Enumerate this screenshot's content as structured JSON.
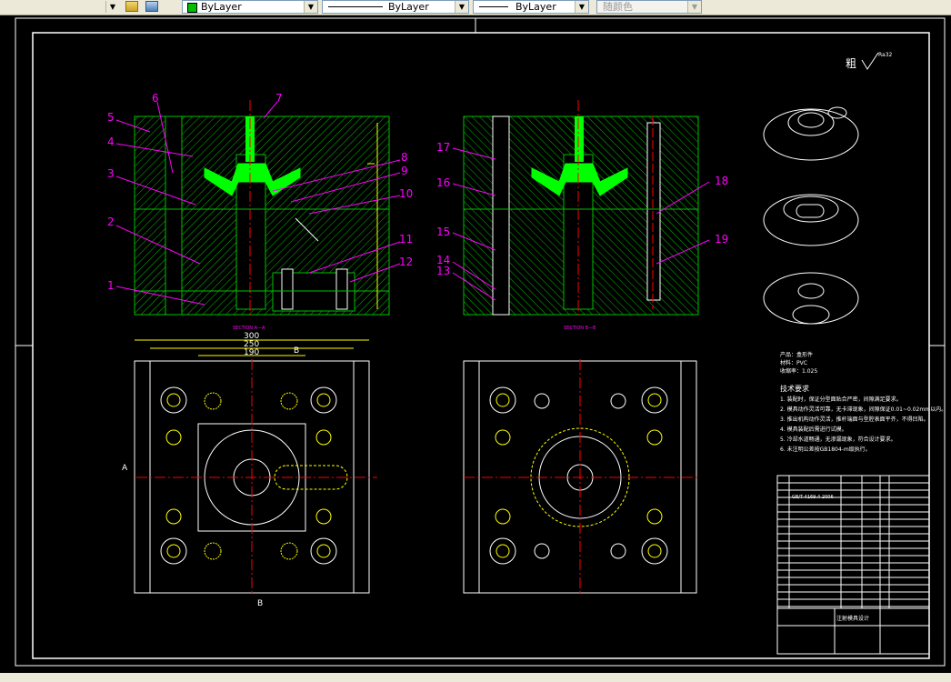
{
  "toolbar": {
    "layer_color": "ByLayer",
    "linetype": "ByLayer",
    "lineweight": "ByLayer",
    "plot_style": "随颜色"
  },
  "drawing": {
    "roughness_label": "粗",
    "roughness_value": "Ra32",
    "section_a_label": "SECTION A—A",
    "section_b_label": "SECTION B—B",
    "dim_300": "300",
    "dim_250": "250",
    "dim_190": "190",
    "label_A": "A",
    "label_B": "B",
    "part_numbers_left": [
      "1",
      "2",
      "3",
      "4",
      "5",
      "6",
      "7",
      "8",
      "9",
      "10",
      "11",
      "12"
    ],
    "part_numbers_right": [
      "13",
      "14",
      "15",
      "16",
      "17",
      "18",
      "19"
    ],
    "product_name": "产品：盒形件",
    "material": "材料：PVC",
    "shrinkage": "收缩率：1.025",
    "tech_title": "技术要求",
    "tech_lines": [
      "1. 装配时，保证分型面贴合严密，间隙满足要求。",
      "2. 模具动作灵活可靠，无卡滞现象，间隙保证0.01~0.02mm以内。",
      "3. 推出机构动作灵活，推杆端面与型腔表面平齐，不得凹陷。",
      "4. 模具装配后需进行试模。",
      "5. 冷却水道畅通，无渗漏现象，符合设计要求。",
      "6. 未注明公差按GB1804-m级执行。"
    ],
    "bom_standard": "GB/T 4169.4-2006",
    "title_block": "注射模具设计"
  }
}
